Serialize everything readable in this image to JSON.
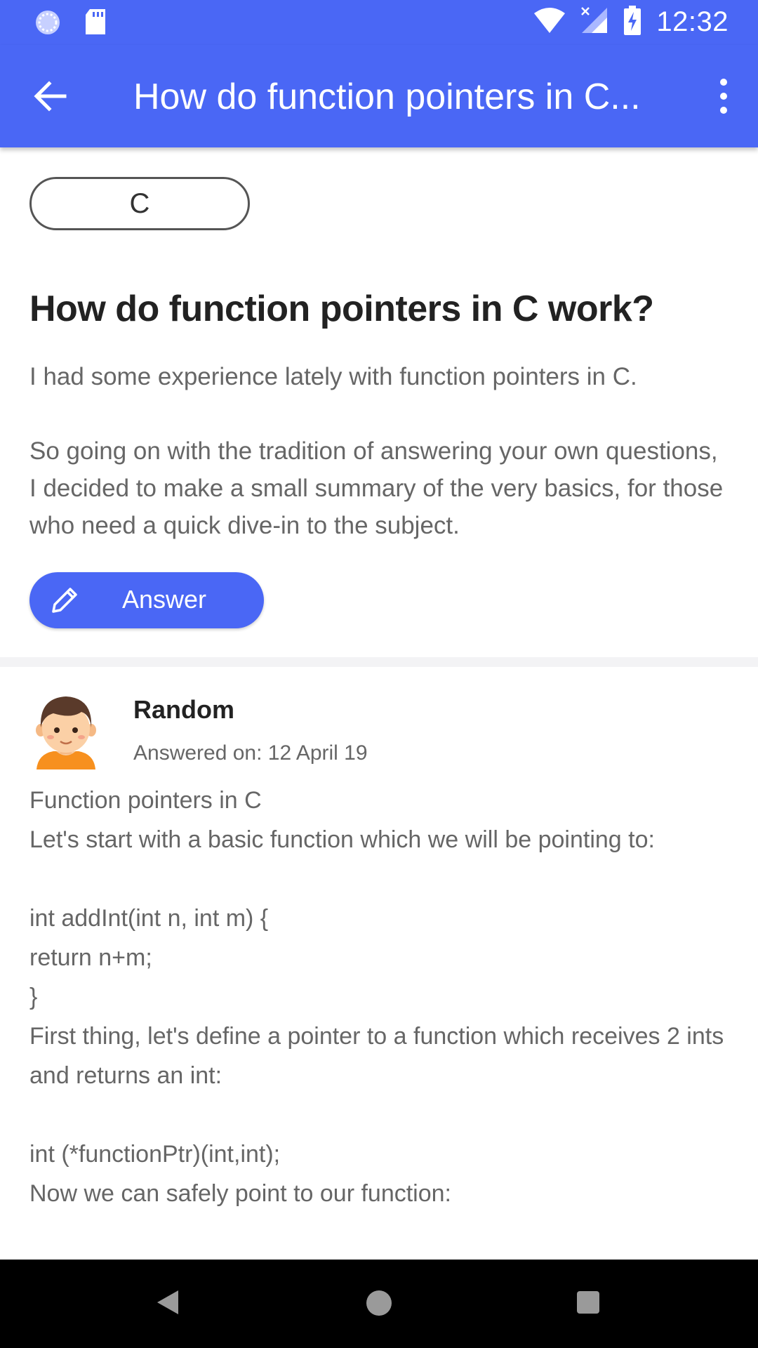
{
  "status_bar": {
    "time": "12:32",
    "icons": [
      "sync-icon",
      "sd-card-icon",
      "wifi-icon",
      "signal-icon",
      "battery-charging-icon"
    ]
  },
  "app_bar": {
    "title": "How do function pointers in C...",
    "back_icon": "arrow-back-icon",
    "menu_icon": "more-vert-icon",
    "background": "#4a67f5"
  },
  "question": {
    "tag": "C",
    "title": "How do function pointers in C work?",
    "body": [
      "I had some experience lately with function pointers in C.",
      "So going on with the tradition of answering your own questions, I decided to make a small summary of the very basics, for those who need a quick dive-in to the subject."
    ]
  },
  "answer_button": {
    "label": "Answer",
    "icon": "pencil-icon"
  },
  "answer": {
    "author": "Random",
    "answered_on": "Answered on: 12 April 19",
    "avatar_icon": "user-avatar-icon",
    "lines": [
      "Function pointers in C",
      "Let's start with a basic function which we will be pointing to:",
      "",
      "int addInt(int n, int m) {",
      "return n+m;",
      "}",
      "First thing, let's define a pointer to a function which receives 2 ints and returns an int:",
      "",
      "int (*functionPtr)(int,int);",
      "Now we can safely point to our function:"
    ]
  },
  "nav_bar": {
    "icons": [
      "nav-back-icon",
      "nav-home-icon",
      "nav-recents-icon"
    ]
  },
  "colors": {
    "accent": "#4a67f5",
    "title_text": "#222222",
    "body_text": "#666666"
  }
}
